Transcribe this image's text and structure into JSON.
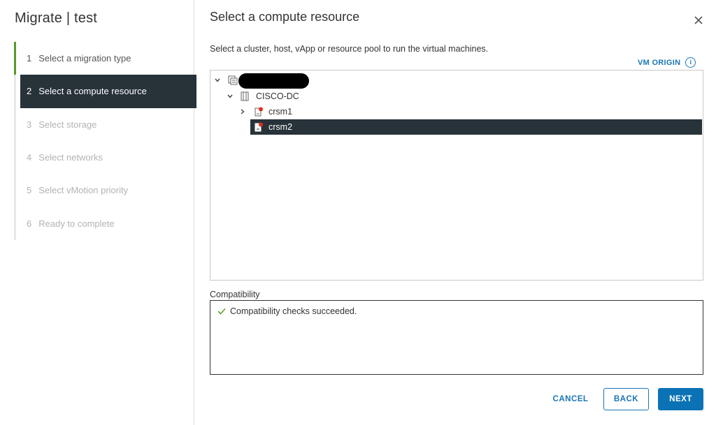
{
  "wizard": {
    "title": "Migrate | test",
    "steps": [
      {
        "num": "1",
        "label": "Select a migration type",
        "state": "done"
      },
      {
        "num": "2",
        "label": "Select a compute resource",
        "state": "active"
      },
      {
        "num": "3",
        "label": "Select storage",
        "state": "future"
      },
      {
        "num": "4",
        "label": "Select networks",
        "state": "future"
      },
      {
        "num": "5",
        "label": "Select vMotion priority",
        "state": "future"
      },
      {
        "num": "6",
        "label": "Ready to complete",
        "state": "future"
      }
    ]
  },
  "main": {
    "title": "Select a compute resource",
    "instruction": "Select a cluster, host, vApp or resource pool to run the virtual machines.",
    "vm_origin_label": "VM ORIGIN",
    "tree": {
      "datacenter": "CISCO-DC",
      "hosts": [
        {
          "name": "crsm1",
          "selected": false
        },
        {
          "name": "crsm2",
          "selected": true
        }
      ]
    },
    "compatibility": {
      "label": "Compatibility",
      "message": "Compatibility checks succeeded."
    }
  },
  "buttons": {
    "cancel": "CANCEL",
    "back": "BACK",
    "next": "NEXT"
  },
  "colors": {
    "accent": "#1a76b8",
    "selected_bg": "#273239",
    "success": "#5a9a2a",
    "primary_button": "#0b72b5"
  }
}
